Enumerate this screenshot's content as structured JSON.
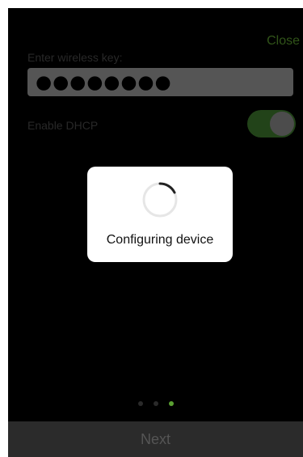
{
  "header": {
    "close_label": "Close"
  },
  "form": {
    "key_label": "Enter wireless key:",
    "key_value": "●●●●●●●●",
    "dhcp_label": "Enable DHCP",
    "dhcp_enabled": true
  },
  "loading": {
    "message": "Configuring device",
    "icon": "spinner-icon"
  },
  "pager": {
    "total": 3,
    "active_index": 2
  },
  "footer": {
    "next_label": "Next"
  },
  "colors": {
    "accent": "#5aa032",
    "toggle_on": "#3f7a2f",
    "field_bg": "#9c9c9c",
    "background": "#000000"
  }
}
